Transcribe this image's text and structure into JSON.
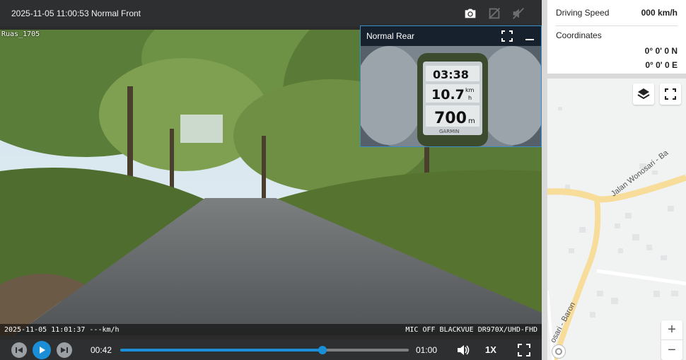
{
  "header": {
    "title": "2025-11-05 11:00:53 Normal Front",
    "icons": [
      "camera-icon",
      "gps-off-icon",
      "mute-icon"
    ]
  },
  "front_video": {
    "location_label": "Ruas_1705",
    "osd_left": "2025-11-05 11:01:37 ---km/h",
    "osd_right": "MIC OFF BLACKVUE DR970X/UHD-FHD"
  },
  "rear_pip": {
    "title": "Normal Rear",
    "gps_time": "03:38",
    "gps_speed": "10.7",
    "gps_speed_unit_top": "km",
    "gps_speed_unit_bottom": "h",
    "gps_distance": "700",
    "gps_distance_unit": "m",
    "gps_brand": "GARMIN"
  },
  "player": {
    "current_time": "00:42",
    "total_time": "01:00",
    "progress_fraction": 0.7,
    "speed": "1X"
  },
  "info": {
    "driving_speed_label": "Driving Speed",
    "driving_speed_value": "000 km/h",
    "coordinates_label": "Coordinates",
    "lat": "0° 0'   0 N",
    "lon": "0° 0'   0 E"
  },
  "map": {
    "road_label_1": "Jalan Wonosari - Ba",
    "road_label_2": "osari - Baron",
    "zoom_in": "+",
    "zoom_out": "−"
  },
  "colors": {
    "accent": "#1a8fd8",
    "header_bg": "#2e2f31",
    "road_yellow": "#f7dc9a"
  }
}
